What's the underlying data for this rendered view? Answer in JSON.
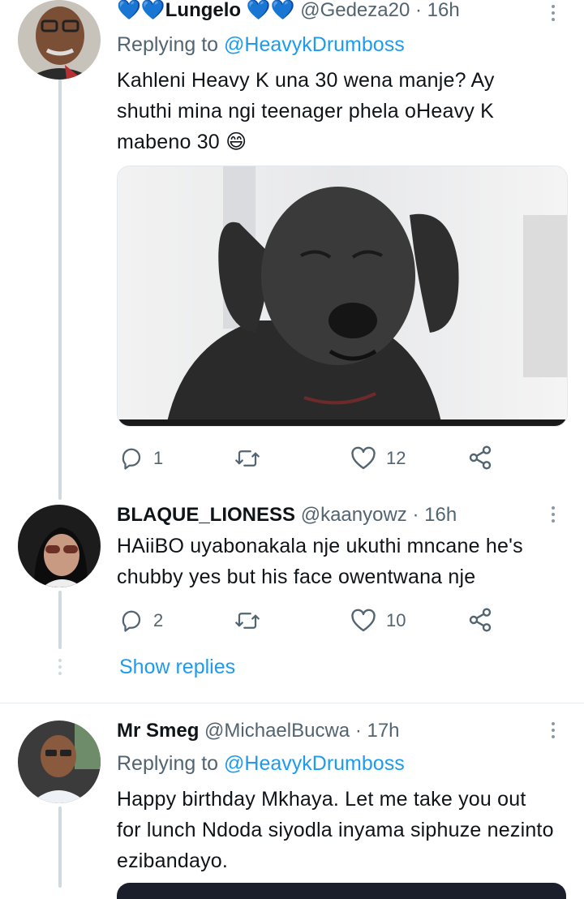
{
  "colors": {
    "accent": "#1d9bf0",
    "muted": "#536471",
    "heart": "#5b9cf2"
  },
  "tweet1": {
    "name": "Lungelo",
    "handle": "@Gedeza20",
    "time": "· 16h",
    "replying_prefix": "Replying to ",
    "replying_handle": "@HeavykDrumboss",
    "text": "Kahleni Heavy K una 30 wena manje? Ay shuthi mina ngi teenager phela oHeavy K mabeno 30",
    "emoji": "😄",
    "replies": "1",
    "likes": "12"
  },
  "tweet2": {
    "name": "BLAQUE_LIONESS",
    "handle": "@kaanyowz",
    "time": "· 16h",
    "text": "HAiiBO uyabonakala nje ukuthi mncane he's chubby yes but his face owentwana nje",
    "replies": "2",
    "likes": "10",
    "show_replies": "Show replies"
  },
  "tweet3": {
    "name": "Mr Smeg",
    "handle": "@MichaelBucwa",
    "time": "· 17h",
    "replying_prefix": "Replying to ",
    "replying_handle": "@HeavykDrumboss",
    "text": "Happy birthday Mkhaya. Let me take you out for lunch Ndoda siyodla inyama siphuze nezinto ezibandayo."
  }
}
